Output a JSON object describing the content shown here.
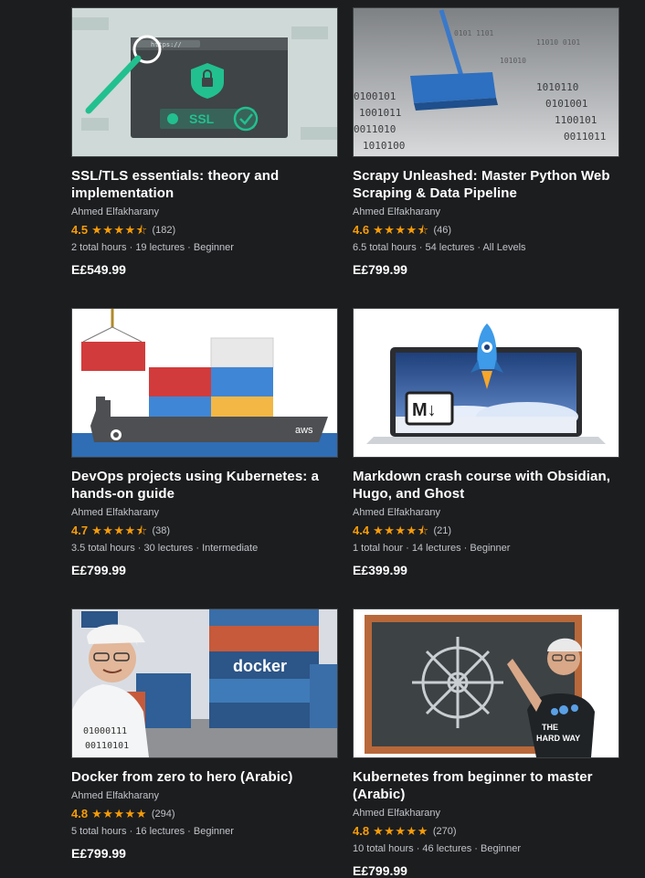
{
  "courses": [
    {
      "title": "SSL/TLS essentials: theory and implementation",
      "author": "Ahmed Elfakharany",
      "rating": "4.5",
      "rating_value": 4.5,
      "stars": "★★★★⯪",
      "reviews": "(182)",
      "meta": "2 total hours · 19 lectures · Beginner",
      "price": "E£549.99",
      "thumb_text": [
        "https://",
        "SSL"
      ]
    },
    {
      "title": "Scrapy Unleashed: Master Python Web Scraping & Data Pipeline",
      "author": "Ahmed Elfakharany",
      "rating": "4.6",
      "rating_value": 4.6,
      "stars": "★★★★⯪",
      "reviews": "(46)",
      "meta": "6.5 total hours · 54 lectures · All Levels",
      "price": "E£799.99",
      "thumb_text": [
        "0100101",
        "1001011",
        "0011010",
        "1010100"
      ]
    },
    {
      "title": "DevOps projects using Kubernetes: a hands-on guide",
      "author": "Ahmed Elfakharany",
      "rating": "4.7",
      "rating_value": 4.7,
      "stars": "★★★★⯪",
      "reviews": "(38)",
      "meta": "3.5 total hours · 30 lectures · Intermediate",
      "price": "E£799.99",
      "thumb_text": [
        "aws"
      ]
    },
    {
      "title": "Markdown crash course with Obsidian, Hugo, and Ghost",
      "author": "Ahmed Elfakharany",
      "rating": "4.4",
      "rating_value": 4.4,
      "stars": "★★★★⯪",
      "reviews": "(21)",
      "meta": "1 total hour · 14 lectures · Beginner",
      "price": "E£399.99",
      "thumb_text": [
        "M↓"
      ]
    },
    {
      "title": "Docker from zero to hero (Arabic)",
      "author": "Ahmed Elfakharany",
      "rating": "4.8",
      "rating_value": 4.8,
      "stars": "★★★★★",
      "reviews": "(294)",
      "meta": "5 total hours · 16 lectures · Beginner",
      "price": "E£799.99",
      "thumb_text": [
        "docker",
        "01000111",
        "00110101"
      ]
    },
    {
      "title": "Kubernetes from beginner to master (Arabic)",
      "author": "Ahmed Elfakharany",
      "rating": "4.8",
      "rating_value": 4.8,
      "stars": "★★★★★",
      "reviews": "(270)",
      "meta": "10 total hours · 46 lectures · Beginner",
      "price": "E£799.99",
      "thumb_text": [
        "THE",
        "HARD WAY"
      ]
    }
  ],
  "colors": {
    "background": "#1c1d1f",
    "rating": "#f69c08",
    "secondary_text": "#c0c4c8"
  }
}
